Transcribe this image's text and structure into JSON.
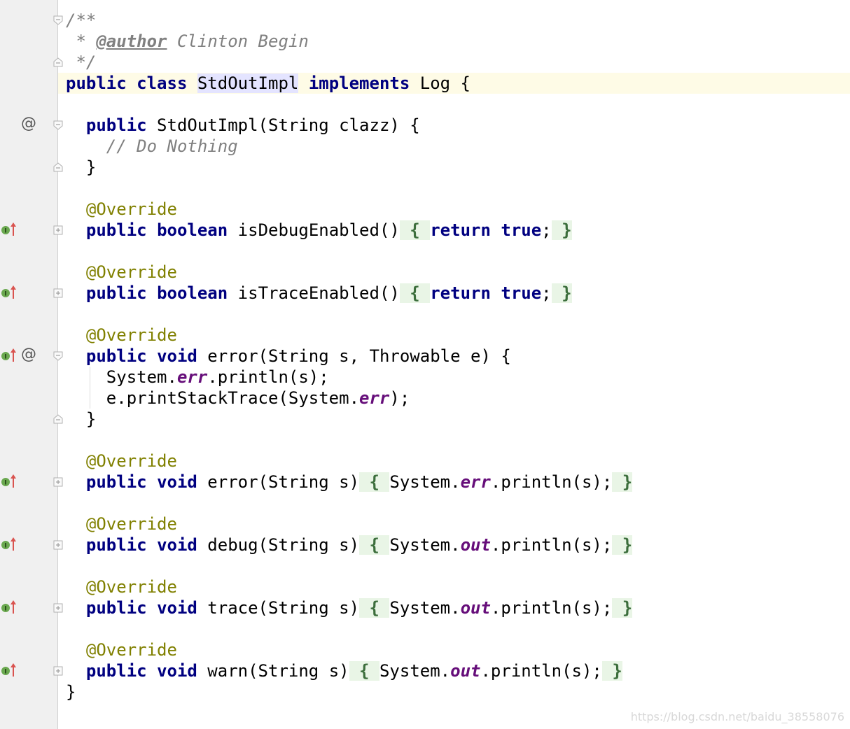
{
  "editor": {
    "lines": [
      {
        "id": "l1",
        "tokens": [
          {
            "t": "/**",
            "c": "cm"
          }
        ]
      },
      {
        "id": "l2",
        "tokens": [
          {
            "t": " * ",
            "c": "cm"
          },
          {
            "t": "@author",
            "c": "tag"
          },
          {
            "t": " Clinton Begin",
            "c": "cm"
          }
        ]
      },
      {
        "id": "l3",
        "tokens": [
          {
            "t": " */",
            "c": "cm"
          }
        ]
      },
      {
        "id": "l4",
        "tokens": [
          {
            "t": "public",
            "c": "kw"
          },
          {
            "t": " ",
            "c": "plain"
          },
          {
            "t": "class",
            "c": "kw"
          },
          {
            "t": " ",
            "c": "plain"
          },
          {
            "t": "StdOutImpl",
            "c": "hl"
          },
          {
            "t": " ",
            "c": "plain"
          },
          {
            "t": "implements",
            "c": "kw"
          },
          {
            "t": " Log {",
            "c": "plain"
          }
        ]
      },
      {
        "id": "l5",
        "tokens": []
      },
      {
        "id": "l6",
        "tokens": [
          {
            "t": "  ",
            "c": "plain"
          },
          {
            "t": "public",
            "c": "kw"
          },
          {
            "t": " StdOutImpl(String clazz) {",
            "c": "plain"
          }
        ]
      },
      {
        "id": "l7",
        "tokens": [
          {
            "t": "    // Do Nothing",
            "c": "cm"
          }
        ]
      },
      {
        "id": "l8",
        "tokens": [
          {
            "t": "  }",
            "c": "plain"
          }
        ]
      },
      {
        "id": "l9",
        "tokens": []
      },
      {
        "id": "l10",
        "tokens": [
          {
            "t": "  ",
            "c": "plain"
          },
          {
            "t": "@Override",
            "c": "ann"
          }
        ]
      },
      {
        "id": "l11",
        "tokens": [
          {
            "t": "  ",
            "c": "plain"
          },
          {
            "t": "public",
            "c": "kw"
          },
          {
            "t": " ",
            "c": "plain"
          },
          {
            "t": "boolean",
            "c": "kw"
          },
          {
            "t": " isDebugEnabled()",
            "c": "plain"
          },
          {
            "t": " { ",
            "c": "fold"
          },
          {
            "t": "return",
            "c": "kw"
          },
          {
            "t": " ",
            "c": "plain"
          },
          {
            "t": "true",
            "c": "kw"
          },
          {
            "t": ";",
            "c": "plain"
          },
          {
            "t": " }",
            "c": "fold"
          }
        ]
      },
      {
        "id": "l12",
        "tokens": []
      },
      {
        "id": "l13",
        "tokens": [
          {
            "t": "  ",
            "c": "plain"
          },
          {
            "t": "@Override",
            "c": "ann"
          }
        ]
      },
      {
        "id": "l14",
        "tokens": [
          {
            "t": "  ",
            "c": "plain"
          },
          {
            "t": "public",
            "c": "kw"
          },
          {
            "t": " ",
            "c": "plain"
          },
          {
            "t": "boolean",
            "c": "kw"
          },
          {
            "t": " isTraceEnabled()",
            "c": "plain"
          },
          {
            "t": " { ",
            "c": "fold"
          },
          {
            "t": "return",
            "c": "kw"
          },
          {
            "t": " ",
            "c": "plain"
          },
          {
            "t": "true",
            "c": "kw"
          },
          {
            "t": ";",
            "c": "plain"
          },
          {
            "t": " }",
            "c": "fold"
          }
        ]
      },
      {
        "id": "l15",
        "tokens": []
      },
      {
        "id": "l16",
        "tokens": [
          {
            "t": "  ",
            "c": "plain"
          },
          {
            "t": "@Override",
            "c": "ann"
          }
        ]
      },
      {
        "id": "l17",
        "tokens": [
          {
            "t": "  ",
            "c": "plain"
          },
          {
            "t": "public",
            "c": "kw"
          },
          {
            "t": " ",
            "c": "plain"
          },
          {
            "t": "void",
            "c": "kw"
          },
          {
            "t": " error(String s, Throwable e) {",
            "c": "plain"
          }
        ]
      },
      {
        "id": "l18",
        "tokens": [
          {
            "t": "    System.",
            "c": "plain"
          },
          {
            "t": "err",
            "c": "field"
          },
          {
            "t": ".println(s);",
            "c": "plain"
          }
        ]
      },
      {
        "id": "l19",
        "tokens": [
          {
            "t": "    e.printStackTrace(System.",
            "c": "plain"
          },
          {
            "t": "err",
            "c": "field"
          },
          {
            "t": ");",
            "c": "plain"
          }
        ]
      },
      {
        "id": "l20",
        "tokens": [
          {
            "t": "  }",
            "c": "plain"
          }
        ]
      },
      {
        "id": "l21",
        "tokens": []
      },
      {
        "id": "l22",
        "tokens": [
          {
            "t": "  ",
            "c": "plain"
          },
          {
            "t": "@Override",
            "c": "ann"
          }
        ]
      },
      {
        "id": "l23",
        "tokens": [
          {
            "t": "  ",
            "c": "plain"
          },
          {
            "t": "public",
            "c": "kw"
          },
          {
            "t": " ",
            "c": "plain"
          },
          {
            "t": "void",
            "c": "kw"
          },
          {
            "t": " error(String s)",
            "c": "plain"
          },
          {
            "t": " { ",
            "c": "fold"
          },
          {
            "t": "System.",
            "c": "plain"
          },
          {
            "t": "err",
            "c": "field"
          },
          {
            "t": ".println(s);",
            "c": "plain"
          },
          {
            "t": " }",
            "c": "fold"
          }
        ]
      },
      {
        "id": "l24",
        "tokens": []
      },
      {
        "id": "l25",
        "tokens": [
          {
            "t": "  ",
            "c": "plain"
          },
          {
            "t": "@Override",
            "c": "ann"
          }
        ]
      },
      {
        "id": "l26",
        "tokens": [
          {
            "t": "  ",
            "c": "plain"
          },
          {
            "t": "public",
            "c": "kw"
          },
          {
            "t": " ",
            "c": "plain"
          },
          {
            "t": "void",
            "c": "kw"
          },
          {
            "t": " debug(String s)",
            "c": "plain"
          },
          {
            "t": " { ",
            "c": "fold"
          },
          {
            "t": "System.",
            "c": "plain"
          },
          {
            "t": "out",
            "c": "field"
          },
          {
            "t": ".println(s);",
            "c": "plain"
          },
          {
            "t": " }",
            "c": "fold"
          }
        ]
      },
      {
        "id": "l27",
        "tokens": []
      },
      {
        "id": "l28",
        "tokens": [
          {
            "t": "  ",
            "c": "plain"
          },
          {
            "t": "@Override",
            "c": "ann"
          }
        ]
      },
      {
        "id": "l29",
        "tokens": [
          {
            "t": "  ",
            "c": "plain"
          },
          {
            "t": "public",
            "c": "kw"
          },
          {
            "t": " ",
            "c": "plain"
          },
          {
            "t": "void",
            "c": "kw"
          },
          {
            "t": " trace(String s)",
            "c": "plain"
          },
          {
            "t": " { ",
            "c": "fold"
          },
          {
            "t": "System.",
            "c": "plain"
          },
          {
            "t": "out",
            "c": "field"
          },
          {
            "t": ".println(s);",
            "c": "plain"
          },
          {
            "t": " }",
            "c": "fold"
          }
        ]
      },
      {
        "id": "l30",
        "tokens": []
      },
      {
        "id": "l31",
        "tokens": [
          {
            "t": "  ",
            "c": "plain"
          },
          {
            "t": "@Override",
            "c": "ann"
          }
        ]
      },
      {
        "id": "l32",
        "tokens": [
          {
            "t": "  ",
            "c": "plain"
          },
          {
            "t": "public",
            "c": "kw"
          },
          {
            "t": " ",
            "c": "plain"
          },
          {
            "t": "void",
            "c": "kw"
          },
          {
            "t": " warn(String s)",
            "c": "plain"
          },
          {
            "t": " { ",
            "c": "fold"
          },
          {
            "t": "System.",
            "c": "plain"
          },
          {
            "t": "out",
            "c": "field"
          },
          {
            "t": ".println(s);",
            "c": "plain"
          },
          {
            "t": " }",
            "c": "fold"
          }
        ]
      },
      {
        "id": "l33",
        "tokens": [
          {
            "t": "}",
            "c": "plain"
          }
        ]
      }
    ],
    "current_line": "l4"
  },
  "gutter": {
    "at_symbol": "@",
    "icons": {
      "fold_open": "fold-open-icon",
      "fold_end": "fold-end-icon",
      "fold_collapsed": "fold-collapsed-icon",
      "implements": "implements-method-icon",
      "related": "related-annotation-icon"
    }
  },
  "watermark": "https://blog.csdn.net/baidu_38558076",
  "colors": {
    "keyword": "#000080",
    "comment": "#808080",
    "annotation": "#808000",
    "field": "#660e7a",
    "current_line": "#fefbe6",
    "folded_region": "#e9f5e6",
    "class_highlight": "#e4e4ff",
    "gutter_bg": "#f0f0f0",
    "implements_icon": "#6aa84f",
    "implements_arrow": "#d9534f"
  }
}
